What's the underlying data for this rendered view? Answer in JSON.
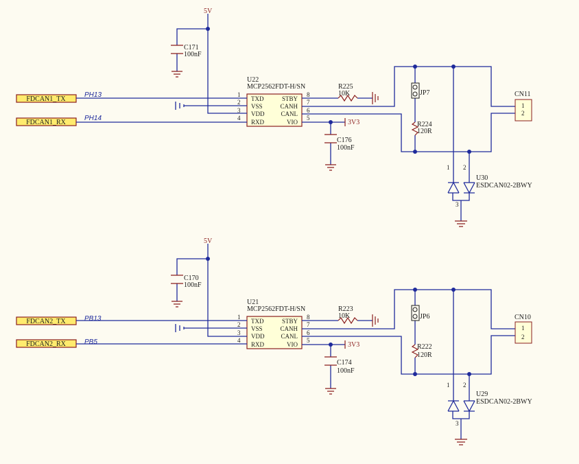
{
  "colors": {
    "wire": "#1e2a9b",
    "component": "#8a1e1e",
    "port_fill": "#ffeb6e",
    "chip_fill": "#ffffd8",
    "background": "#fdfbf1"
  },
  "channels": [
    {
      "port_tx": "FDCAN1_TX",
      "port_rx": "FDCAN1_RX",
      "net_tx": "PH13",
      "net_rx": "PH14",
      "power": "5V",
      "vio": "3V3",
      "chip_ref": "U22",
      "chip_part": "MCP2562FDT-H/SN",
      "left_pins": [
        "TXD",
        "VSS",
        "VDD",
        "RXD"
      ],
      "right_pins": [
        "STBY",
        "CANH",
        "CANL",
        "VIO"
      ],
      "left_nums": [
        "1",
        "2",
        "3",
        "4"
      ],
      "right_nums": [
        "8",
        "7",
        "6",
        "5"
      ],
      "cap_top_ref": "C171",
      "cap_top_val": "100nF",
      "cap_bot_ref": "C176",
      "cap_bot_val": "100nF",
      "res_stby_ref": "R225",
      "res_stby_val": "10K",
      "res_term_ref": "R224",
      "res_term_val": "120R",
      "jumper_ref": "JP7",
      "conn_ref": "CN11",
      "conn_pins": [
        "1",
        "2"
      ],
      "esd_ref": "U30",
      "esd_part": "ESDCAN02-2BWY",
      "esd_pins": [
        "1",
        "2",
        "3"
      ]
    },
    {
      "port_tx": "FDCAN2_TX",
      "port_rx": "FDCAN2_RX",
      "net_tx": "PB13",
      "net_rx": "PB5",
      "power": "5V",
      "vio": "3V3",
      "chip_ref": "U21",
      "chip_part": "MCP2562FDT-H/SN",
      "left_pins": [
        "TXD",
        "VSS",
        "VDD",
        "RXD"
      ],
      "right_pins": [
        "STBY",
        "CANH",
        "CANL",
        "VIO"
      ],
      "left_nums": [
        "1",
        "2",
        "3",
        "4"
      ],
      "right_nums": [
        "8",
        "7",
        "6",
        "5"
      ],
      "cap_top_ref": "C170",
      "cap_top_val": "100nF",
      "cap_bot_ref": "C174",
      "cap_bot_val": "100nF",
      "res_stby_ref": "R223",
      "res_stby_val": "10K",
      "res_term_ref": "R222",
      "res_term_val": "120R",
      "jumper_ref": "JP6",
      "conn_ref": "CN10",
      "conn_pins": [
        "1",
        "2"
      ],
      "esd_ref": "U29",
      "esd_part": "ESDCAN02-2BWY",
      "esd_pins": [
        "1",
        "2",
        "3"
      ]
    }
  ]
}
